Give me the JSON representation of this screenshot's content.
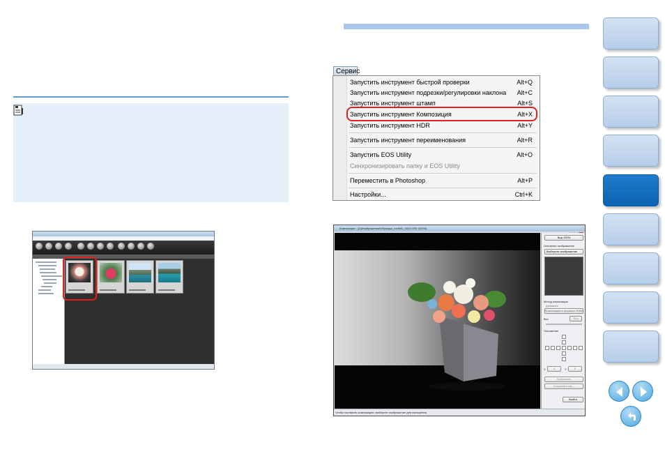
{
  "service_menu": {
    "tab_label": "Сервис",
    "items": [
      {
        "label": "Запустить инструмент быстрой проверки",
        "shortcut": "Alt+Q",
        "enabled": true
      },
      {
        "label": "Запустить инструмент подрезки/регулировки наклона",
        "shortcut": "Alt+C",
        "enabled": true
      },
      {
        "label": "Запустить инструмент штамп",
        "shortcut": "Alt+S",
        "enabled": true
      },
      {
        "label": "Запустить инструмент Композиция",
        "shortcut": "Alt+X",
        "enabled": true,
        "highlighted": true
      },
      {
        "label": "Запустить инструмент HDR",
        "shortcut": "Alt+Y",
        "enabled": true
      },
      {
        "label": "Запустить инструмент переименования",
        "shortcut": "Alt+R",
        "enabled": true
      },
      {
        "label": "Запустить EOS Utility",
        "shortcut": "Alt+O",
        "enabled": true
      },
      {
        "label": "Синхронизировать папку и EOS Utility",
        "shortcut": "",
        "enabled": false
      },
      {
        "label": "Переместить в Photoshop",
        "shortcut": "Alt+P",
        "enabled": true
      },
      {
        "label": "Настройки...",
        "shortcut": "Ctrl+K",
        "enabled": true
      }
    ]
  },
  "composition_tool": {
    "title": "Композиция - (2)\\Изображения\\Образцы\\_ex\\IMG_0033.CR2 (100%)",
    "panel": {
      "view_button": "Вид 100%",
      "base_image_label": "Основное изображение",
      "base_image_select": "Выберите изображение",
      "composition_method_label": "Метод композиции",
      "add_option": "Добавить",
      "raw_option": "Композиция в формате RAW",
      "weight_label": "Вес",
      "weight_value": "78,0",
      "position_label": "Положение",
      "x_label": "X",
      "x_value": "0",
      "y_label": "Y",
      "y_value": "0",
      "apply_button": "Применить",
      "save_as_button": "Сохранить как...",
      "exit_button": "Выйти"
    },
    "status_text": "Чтобы составить композицию, выберите изображение для наложения."
  },
  "colors": {
    "accent_blue": "#5b9bd5",
    "highlight_red": "#e02020",
    "note_bg": "#e6f0fb",
    "active_tab": "#0b63b0",
    "nav_tab": "#c6d9ef"
  },
  "icons": {
    "note": "note-icon",
    "prev": "arrow-left-icon",
    "next": "arrow-right-icon",
    "back": "return-icon"
  }
}
